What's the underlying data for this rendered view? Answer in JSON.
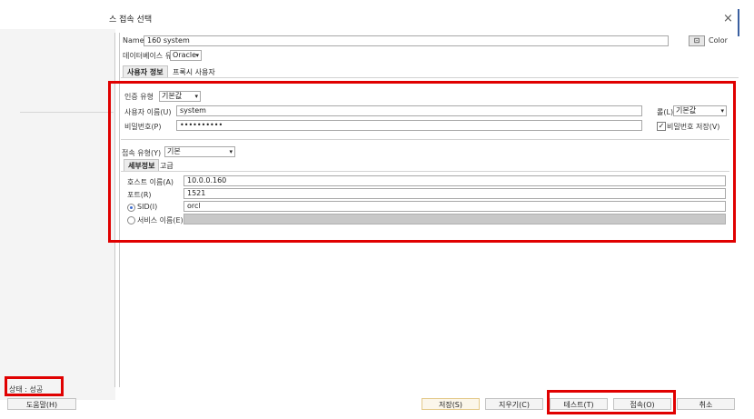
{
  "window": {
    "title": "스 접속 선택",
    "close_label": "×"
  },
  "connection": {
    "name_label": "Name",
    "name_value": "160 system",
    "color_label": "Color",
    "db_type_label": "데이터베이스 유형",
    "db_type_value": "Oracle"
  },
  "outer_tabs": [
    "사용자 정보",
    "프록시 사용자"
  ],
  "auth": {
    "auth_type_label": "인증 유형",
    "auth_type_value": "기본값",
    "username_label": "사용자 이름(U)",
    "username_value": "system",
    "password_label": "비밀번호(P)",
    "password_value": "••••••••••",
    "role_label": "롤(L)",
    "role_value": "기본값",
    "save_password_label": "비밀번호 저장(V)",
    "save_password_checked": true
  },
  "conn": {
    "conn_type_label": "접속 유형(Y)",
    "conn_type_value": "기본",
    "inner_tabs": [
      "세부정보",
      "고급"
    ],
    "hostname_label": "호스트 이름(A)",
    "hostname_value": "10.0.0.160",
    "port_label": "포트(R)",
    "port_value": "1521",
    "sid_label": "SID(I)",
    "sid_value": "orcl",
    "service_label": "서비스 이름(E)",
    "service_value": ""
  },
  "status": {
    "text": "상태 : 성공"
  },
  "buttons": {
    "help": "도움말(H)",
    "save": "저장(S)",
    "clear": "지우기(C)",
    "test": "테스트(T)",
    "connect": "접속(O)",
    "cancel": "취소"
  },
  "colors": {
    "highlight_red": "#e00000",
    "accent_blue": "#3a5fa0"
  }
}
